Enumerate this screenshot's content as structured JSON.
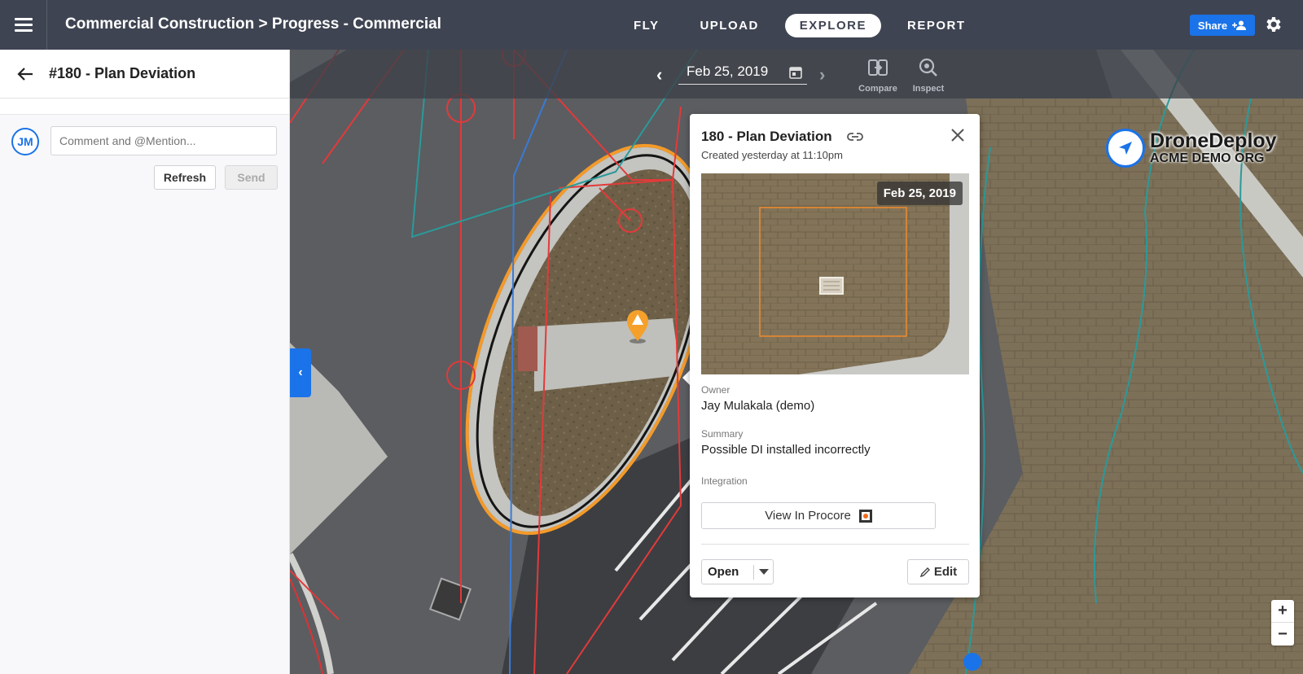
{
  "header": {
    "breadcrumb": "Commercial Construction > Progress - Commercial",
    "tabs": [
      {
        "label": "FLY",
        "active": false
      },
      {
        "label": "UPLOAD",
        "active": false
      },
      {
        "label": "EXPLORE",
        "active": true
      },
      {
        "label": "REPORT",
        "active": false
      }
    ],
    "share_label": "Share"
  },
  "left_panel": {
    "title": "#180 - Plan Deviation",
    "avatar_initials": "JM",
    "comment_placeholder": "Comment and @Mention...",
    "refresh_label": "Refresh",
    "send_label": "Send"
  },
  "map": {
    "date": "Feb 25, 2019",
    "tools": {
      "compare_label": "Compare",
      "inspect_label": "Inspect"
    },
    "logo": {
      "brand": "DroneDeploy",
      "org": "ACME DEMO ORG"
    },
    "zoom": {
      "in": "+",
      "out": "−"
    }
  },
  "issue_card": {
    "title": "180 - Plan Deviation",
    "created": "Created yesterday at 11:10pm",
    "image_date": "Feb 25, 2019",
    "owner_label": "Owner",
    "owner": "Jay Mulakala (demo)",
    "summary_label": "Summary",
    "summary": "Possible DI installed incorrectly",
    "integration_label": "Integration",
    "procore_button": "View In Procore",
    "status": "Open",
    "edit_label": "Edit"
  },
  "colors": {
    "accent": "#1a73e8",
    "topbar": "#3f4452",
    "warning_marker": "#f5a02a"
  }
}
